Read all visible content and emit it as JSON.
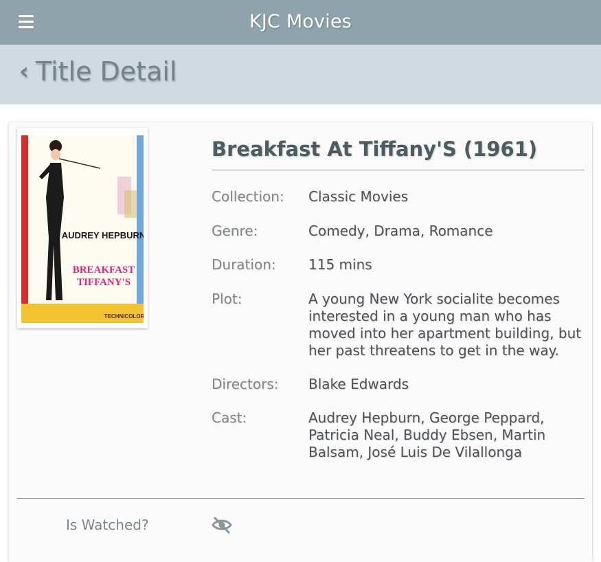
{
  "app": {
    "title": "KJC Movies"
  },
  "header": {
    "back_label": "Title Detail"
  },
  "movie": {
    "title": "Breakfast At Tiffany'S (1961)",
    "poster": {
      "star": "AUDREY HEPBURN",
      "title_line1": "BREAKFAST",
      "title_line2": "TIFFANY'S",
      "footer": "TECHNICOLOR"
    },
    "fields": [
      {
        "label": "Collection:",
        "value": "Classic Movies"
      },
      {
        "label": "Genre:",
        "value": "Comedy, Drama, Romance"
      },
      {
        "label": "Duration:",
        "value": "115 mins"
      },
      {
        "label": "Plot:",
        "value": "A young New York socialite becomes interested in a young man who has moved into her apartment building, but her past threatens to get in the way."
      },
      {
        "label": "Directors:",
        "value": "Blake Edwards"
      },
      {
        "label": "Cast:",
        "value": "Audrey Hepburn, George Peppard, Patricia Neal, Buddy Ebsen, Martin Balsam, José Luis De Vilallonga"
      }
    ],
    "watched": {
      "label": "Is Watched?",
      "icon": "eye-slash-icon"
    }
  },
  "colors": {
    "topbar": "#8fa3ad",
    "subheader": "#d0dae1"
  }
}
